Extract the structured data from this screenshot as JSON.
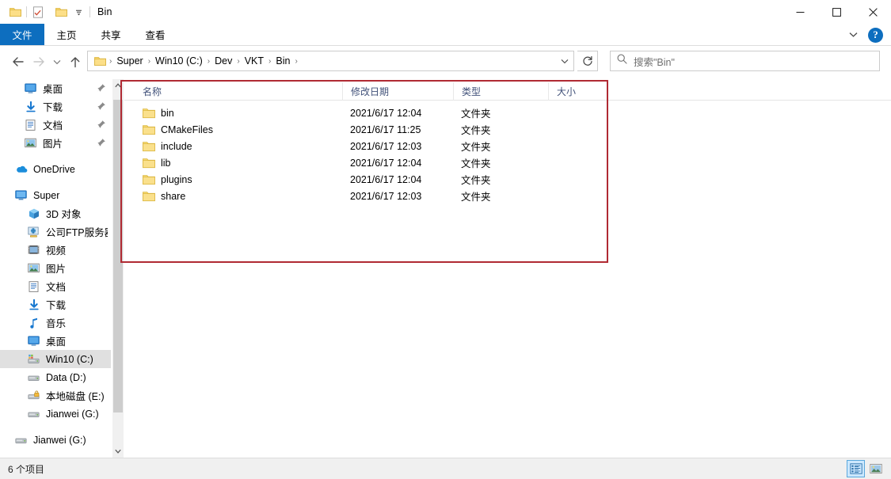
{
  "window": {
    "title": "Bin",
    "quick_access": [
      {
        "name": "folder-icon",
        "label": "Folder"
      },
      {
        "name": "properties-icon",
        "label": "Properties"
      },
      {
        "name": "new-folder-icon",
        "label": "New folder"
      },
      {
        "name": "chevron-down-icon",
        "label": "Customize Quick Access Toolbar"
      }
    ],
    "controls": {
      "minimize": "─",
      "maximize": "□",
      "close": "✕"
    }
  },
  "ribbon": {
    "tabs": [
      {
        "label": "文件",
        "active": true
      },
      {
        "label": "主页",
        "active": false
      },
      {
        "label": "共享",
        "active": false
      },
      {
        "label": "查看",
        "active": false
      }
    ],
    "expand_label": "⌄",
    "help_label": "?",
    "active_color": "#0d6ebf"
  },
  "nav": {
    "back": "←",
    "forward": "→",
    "recent": "⌄",
    "up": "↑",
    "breadcrumbs": [
      "Super",
      "Win10 (C:)",
      "Dev",
      "VKT",
      "Bin"
    ],
    "separator": "›",
    "address_dropdown": "⌄",
    "refresh": "↻"
  },
  "search": {
    "placeholder": "搜索\"Bin\"",
    "icon": "search-icon"
  },
  "sidebar": {
    "groups": [
      {
        "items": [
          {
            "label": "桌面",
            "icon": "desktop-icon",
            "pinned": true,
            "selected": false
          },
          {
            "label": "下载",
            "icon": "download-icon",
            "pinned": true,
            "selected": false
          },
          {
            "label": "文档",
            "icon": "documents-icon",
            "pinned": true,
            "selected": false
          },
          {
            "label": "图片",
            "icon": "pictures-icon",
            "pinned": true,
            "selected": false
          }
        ]
      },
      {
        "items": [
          {
            "label": "OneDrive",
            "icon": "onedrive-icon",
            "pinned": false,
            "selected": false
          }
        ]
      },
      {
        "items": [
          {
            "label": "Super",
            "icon": "pc-icon",
            "pinned": false,
            "selected": false
          },
          {
            "label": "3D 对象",
            "icon": "3d-objects-icon",
            "pinned": false,
            "selected": false,
            "indent": true
          },
          {
            "label": "公司FTP服务器",
            "icon": "ftp-icon",
            "pinned": false,
            "selected": false,
            "indent": true
          },
          {
            "label": "视频",
            "icon": "videos-icon",
            "pinned": false,
            "selected": false,
            "indent": true
          },
          {
            "label": "图片",
            "icon": "pictures-icon",
            "pinned": false,
            "selected": false,
            "indent": true
          },
          {
            "label": "文档",
            "icon": "documents-icon",
            "pinned": false,
            "selected": false,
            "indent": true
          },
          {
            "label": "下载",
            "icon": "download-icon",
            "pinned": false,
            "selected": false,
            "indent": true
          },
          {
            "label": "音乐",
            "icon": "music-icon",
            "pinned": false,
            "selected": false,
            "indent": true
          },
          {
            "label": "桌面",
            "icon": "desktop-icon",
            "pinned": false,
            "selected": false,
            "indent": true
          },
          {
            "label": "Win10 (C:)",
            "icon": "os-drive-icon",
            "pinned": false,
            "selected": true,
            "indent": true
          },
          {
            "label": "Data (D:)",
            "icon": "drive-icon",
            "pinned": false,
            "selected": false,
            "indent": true
          },
          {
            "label": "本地磁盘 (E:)",
            "icon": "locked-drive-icon",
            "pinned": false,
            "selected": false,
            "indent": true
          },
          {
            "label": "Jianwei (G:)",
            "icon": "drive-icon",
            "pinned": false,
            "selected": false,
            "indent": true
          }
        ]
      },
      {
        "items": [
          {
            "label": "Jianwei (G:)",
            "icon": "drive-icon",
            "pinned": false,
            "selected": false
          }
        ]
      }
    ]
  },
  "filelist": {
    "columns": [
      {
        "label": "名称",
        "key": "name"
      },
      {
        "label": "修改日期",
        "key": "date"
      },
      {
        "label": "类型",
        "key": "type"
      },
      {
        "label": "大小",
        "key": "size"
      }
    ],
    "rows": [
      {
        "name": "bin",
        "date": "2021/6/17 12:04",
        "type": "文件夹",
        "size": "",
        "icon": "folder-icon"
      },
      {
        "name": "CMakeFiles",
        "date": "2021/6/17 11:25",
        "type": "文件夹",
        "size": "",
        "icon": "folder-icon"
      },
      {
        "name": "include",
        "date": "2021/6/17 12:03",
        "type": "文件夹",
        "size": "",
        "icon": "folder-icon"
      },
      {
        "name": "lib",
        "date": "2021/6/17 12:04",
        "type": "文件夹",
        "size": "",
        "icon": "folder-icon"
      },
      {
        "name": "plugins",
        "date": "2021/6/17 12:04",
        "type": "文件夹",
        "size": "",
        "icon": "folder-icon"
      },
      {
        "name": "share",
        "date": "2021/6/17 12:03",
        "type": "文件夹",
        "size": "",
        "icon": "folder-icon"
      }
    ]
  },
  "annotation": {
    "color": "#b02a33",
    "shape": "rectangle"
  },
  "statusbar": {
    "item_count_text": "6 个项目",
    "views": [
      {
        "name": "details-view-button",
        "active": true
      },
      {
        "name": "large-icons-view-button",
        "active": false
      }
    ]
  }
}
